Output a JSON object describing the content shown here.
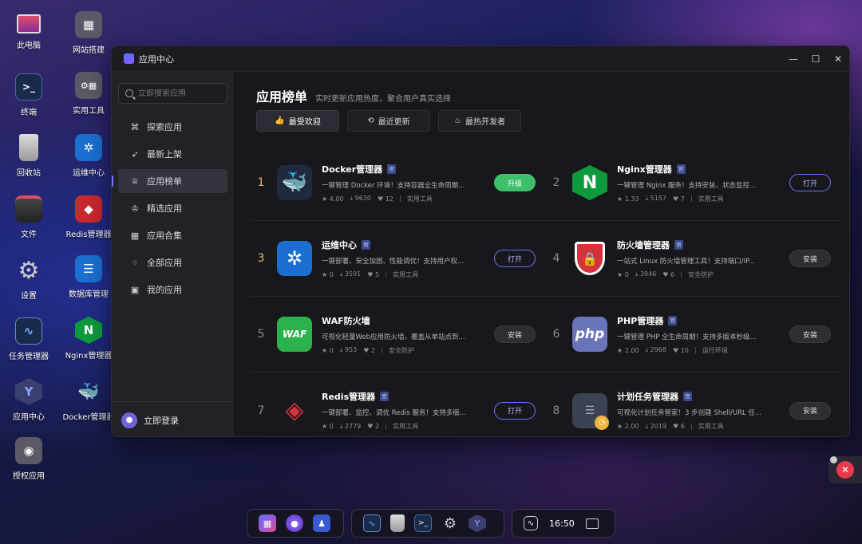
{
  "desktop": {
    "icons": [
      {
        "label": "此电脑",
        "icon": "monitor-icon"
      },
      {
        "label": "网站搭建",
        "icon": "website-icon"
      },
      {
        "label": "终端",
        "icon": "terminal-icon"
      },
      {
        "label": "实用工具",
        "icon": "tools-icon"
      },
      {
        "label": "回收站",
        "icon": "trash-icon"
      },
      {
        "label": "运维中心",
        "icon": "ops-icon"
      },
      {
        "label": "文件",
        "icon": "folder-icon"
      },
      {
        "label": "Redis管理器",
        "icon": "redis-icon"
      },
      {
        "label": "设置",
        "icon": "gear-icon"
      },
      {
        "label": "数据库管理",
        "icon": "database-icon"
      },
      {
        "label": "任务管理器",
        "icon": "task-icon"
      },
      {
        "label": "Nginx管理器",
        "icon": "nginx-icon"
      },
      {
        "label": "应用中心",
        "icon": "appcenter-icon"
      },
      {
        "label": "Docker管理器",
        "icon": "docker-icon"
      },
      {
        "label": "授权应用",
        "icon": "license-icon"
      }
    ]
  },
  "window": {
    "title": "应用中心",
    "controls": {
      "minimize": "—",
      "maximize": "☐",
      "close": "✕"
    }
  },
  "sidebar": {
    "search_placeholder": "立即搜索应用",
    "items": [
      {
        "label": "探索应用",
        "icon": "explore-icon"
      },
      {
        "label": "最新上架",
        "icon": "rocket-icon"
      },
      {
        "label": "应用榜单",
        "icon": "trophy-icon"
      },
      {
        "label": "精选应用",
        "icon": "crown-icon"
      },
      {
        "label": "应用合集",
        "icon": "grid-icon"
      },
      {
        "label": "全部应用",
        "icon": "dots-grid-icon"
      },
      {
        "label": "我的应用",
        "icon": "bag-icon"
      }
    ],
    "active_index": 2,
    "login_label": "立即登录"
  },
  "main": {
    "title": "应用榜单",
    "subtitle": "实时更新应用热度，聚合用户真实选择",
    "tabs": [
      {
        "label": "最受欢迎",
        "icon": "thumb-up-icon"
      },
      {
        "label": "最近更新",
        "icon": "refresh-icon"
      },
      {
        "label": "最热开发者",
        "icon": "flame-icon"
      }
    ],
    "badge": "官",
    "apps": [
      {
        "rank": "1",
        "name": "Docker管理器",
        "desc": "一键管理 Docker 环境！支持容器全生命周期...",
        "rating": "4.00",
        "downloads": "9630",
        "likes": "12",
        "category": "实用工具",
        "action": "升级",
        "action_type": "upgrade",
        "icon": "docker-icon",
        "color": "#1e2a40"
      },
      {
        "rank": "2",
        "name": "Nginx管理器",
        "desc": "一键管理 Nginx 服务！支持安装、状态监控...",
        "rating": "1.33",
        "downloads": "5157",
        "likes": "7",
        "category": "实用工具",
        "action": "打开",
        "action_type": "open",
        "icon": "nginx-icon",
        "color": "#0d9a3c"
      },
      {
        "rank": "3",
        "name": "运维中心",
        "desc": "一键部署、安全加固、性能调优！支持用户权...",
        "rating": "0",
        "downloads": "3591",
        "likes": "5",
        "category": "实用工具",
        "action": "打开",
        "action_type": "open",
        "icon": "ops-icon",
        "color": "#1a6fd0"
      },
      {
        "rank": "4",
        "name": "防火墙管理器",
        "desc": "一站式 Linux 防火墙管理工具！支持端口/IP...",
        "rating": "0",
        "downloads": "3946",
        "likes": "6",
        "category": "安全防护",
        "action": "安装",
        "action_type": "install",
        "icon": "firewall-icon",
        "color": "#d6323c"
      },
      {
        "rank": "5",
        "name": "WAF防火墙",
        "desc": "可视化轻量Web应用防火墙，覆盖从单站点到...",
        "rating": "0",
        "downloads": "953",
        "likes": "2",
        "category": "安全防护",
        "action": "安装",
        "action_type": "install",
        "icon": "waf-icon",
        "color": "#2bb24c"
      },
      {
        "rank": "6",
        "name": "PHP管理器",
        "desc": "一键管理 PHP 全生命周期！支持多版本秒级...",
        "rating": "2.00",
        "downloads": "2968",
        "likes": "10",
        "category": "运行环境",
        "action": "安装",
        "action_type": "install",
        "icon": "php-icon",
        "color": "#6a74b8"
      },
      {
        "rank": "7",
        "name": "Redis管理器",
        "desc": "一键部署、监控、调优 Redis 服务！支持多版...",
        "rating": "0",
        "downloads": "2779",
        "likes": "2",
        "category": "实用工具",
        "action": "打开",
        "action_type": "open",
        "icon": "redis-icon",
        "color": "#1e1d24"
      },
      {
        "rank": "8",
        "name": "计划任务管理器",
        "desc": "可视化计划任务管家！3 步创建 Shell/URL 任...",
        "rating": "2.00",
        "downloads": "2019",
        "likes": "6",
        "category": "实用工具",
        "action": "安装",
        "action_type": "install",
        "icon": "cron-icon",
        "color": "#3b4252"
      }
    ]
  },
  "taskbar": {
    "clock": "16:50"
  }
}
